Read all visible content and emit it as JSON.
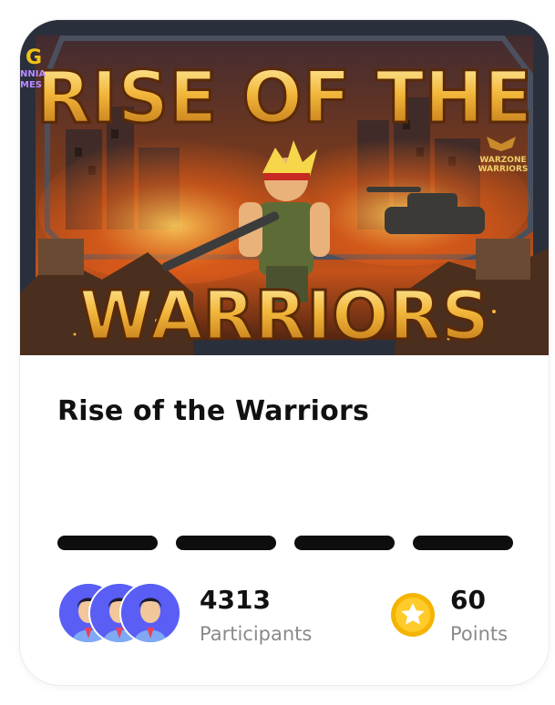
{
  "game": {
    "title": "Rise of the Warriors",
    "banner": {
      "headline_top": "RISE OF THE",
      "headline_bottom": "WARRIORS",
      "publisher_logo": "NNIA\nMES",
      "badge_logo": "WARZONE\nWARRIORS"
    }
  },
  "progress": {
    "segments": 4,
    "filled": 4,
    "color": "#0e0e0e"
  },
  "participants": {
    "count": "4313",
    "label": "Participants",
    "avatar_icon": "person-avatar-icon",
    "avatar_color": "#5a5ef5"
  },
  "points": {
    "value": "60",
    "label": "Points",
    "icon": "star-coin-icon",
    "coin_color": "#f5b400"
  }
}
